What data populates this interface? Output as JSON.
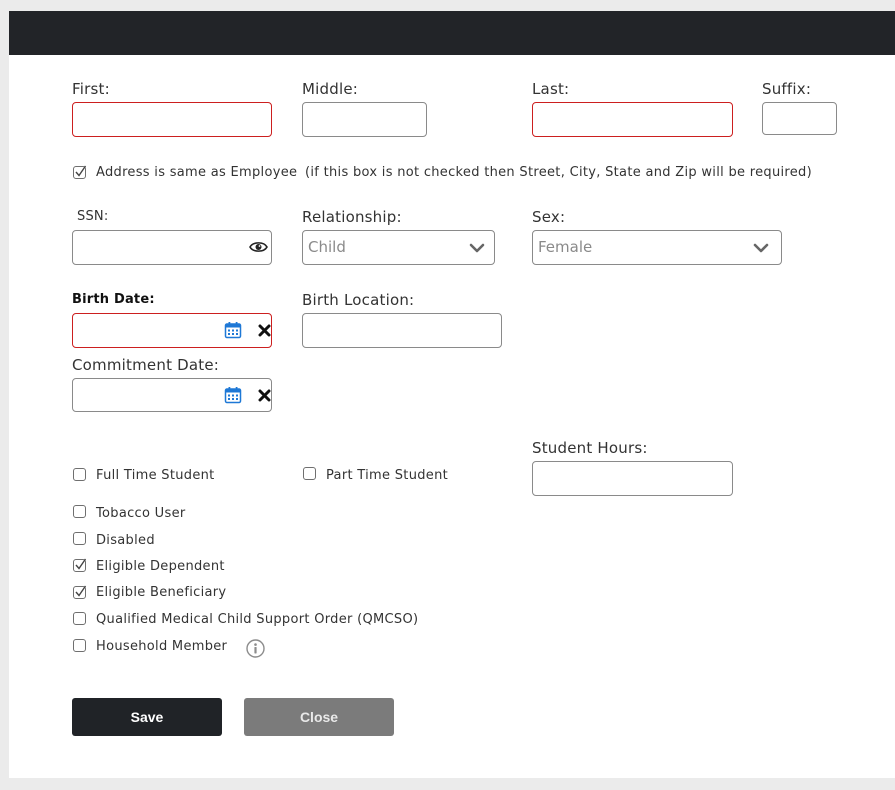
{
  "name": {
    "first_label": "First:",
    "middle_label": "Middle:",
    "last_label": "Last:",
    "suffix_label": "Suffix:"
  },
  "address": {
    "checked": true,
    "label": "Address is same as Employee",
    "note": "(if this box is not checked then Street, City, State and Zip will be required)"
  },
  "details": {
    "ssn_label": "SSN:",
    "relationship_label": "Relationship:",
    "relationship_value": "Child",
    "sex_label": "Sex:",
    "sex_value": "Female",
    "birth_date_label": "Birth Date:",
    "birth_location_label": "Birth Location:",
    "commitment_date_label": "Commitment Date:",
    "student_hours_label": "Student Hours:"
  },
  "checkboxes": {
    "full_time_student": {
      "label": "Full Time Student",
      "checked": false
    },
    "part_time_student": {
      "label": "Part Time Student",
      "checked": false
    },
    "tobacco_user": {
      "label": "Tobacco User",
      "checked": false
    },
    "disabled": {
      "label": "Disabled",
      "checked": false
    },
    "eligible_dependent": {
      "label": "Eligible Dependent",
      "checked": true
    },
    "eligible_beneficiary": {
      "label": "Eligible Beneficiary",
      "checked": true
    },
    "qmcso": {
      "label": "Qualified Medical Child Support Order (QMCSO)",
      "checked": false
    },
    "household_member": {
      "label": "Household Member",
      "checked": false
    }
  },
  "buttons": {
    "save_label": "Save",
    "close_label": "Close"
  },
  "colors": {
    "required_border": "#cc1f1f",
    "header_bar": "#222428",
    "save_button": "#202327",
    "close_button": "#7b7b7b",
    "calendar_icon": "#1e78d6"
  },
  "icons": {
    "ssn_toggle": "eye-icon",
    "date_picker": "calendar-icon",
    "date_clear": "close-icon",
    "select_arrow": "chevron-down-icon",
    "info": "info-icon"
  }
}
